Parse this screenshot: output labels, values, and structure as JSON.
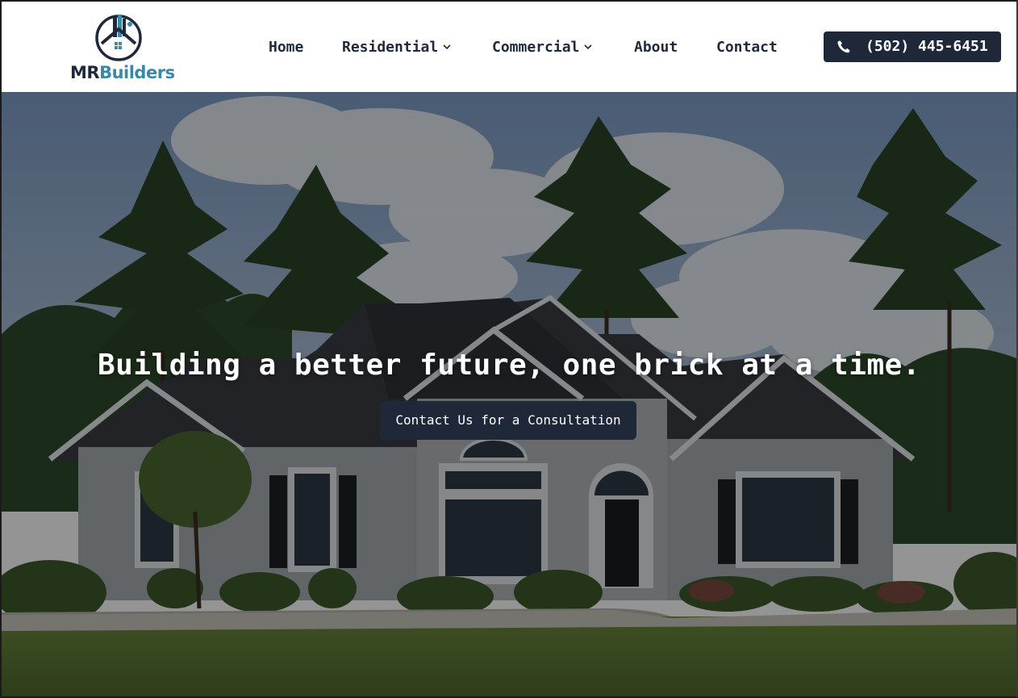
{
  "brand": {
    "logo_part1": "MR",
    "logo_part2": "Builders",
    "logo_icon": "house-buildings-icon",
    "color_dark": "#1e2a3c",
    "color_accent": "#3b88a8"
  },
  "nav": {
    "items": [
      {
        "label": "Home",
        "has_dropdown": false
      },
      {
        "label": "Residential",
        "has_dropdown": true,
        "dropdown_icon": "chevron-down-icon"
      },
      {
        "label": "Commercial",
        "has_dropdown": true,
        "dropdown_icon": "chevron-down-icon"
      },
      {
        "label": "About",
        "has_dropdown": false
      },
      {
        "label": "Contact",
        "has_dropdown": false
      }
    ],
    "phone": {
      "icon": "phone-icon",
      "number": "(502) 445-6451",
      "bg_color": "#1e2839"
    }
  },
  "hero": {
    "background": "photo of a gray single-story house with dark roof, tall pine trees and a green lawn",
    "headline": "Building a better future, one brick at a time.",
    "cta_label": "Contact Us for a Consultation",
    "cta_color": "#1e2839"
  }
}
